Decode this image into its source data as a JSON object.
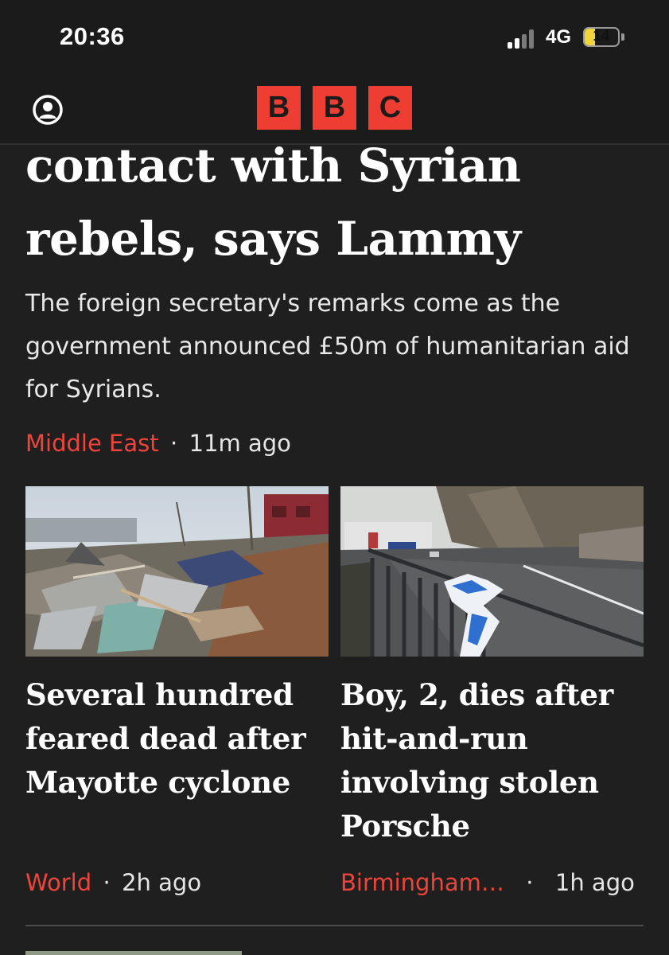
{
  "status_bar": {
    "time": "20:36",
    "network": "4G",
    "battery": "14",
    "battery_fraction": 0.3
  },
  "app_bar": {
    "account_icon": "account-icon",
    "logo_letters": [
      "B",
      "B",
      "C"
    ]
  },
  "lead_story": {
    "title": "contact with Syrian rebels, says Lammy",
    "summary": "The foreign secretary's remarks come as the government announced £50m of humanitarian aid for Syrians.",
    "category": "Middle East",
    "time": "11m ago"
  },
  "stories": [
    {
      "title": "Several hundred feared dead after Mayotte cyclone",
      "category": "World",
      "time": "2h ago"
    },
    {
      "title": "Boy, 2, dies after hit-and-run involving stolen Porsche",
      "category": "Birmingham…",
      "time": "1h ago"
    }
  ],
  "colors": {
    "background": "#1f1f1f",
    "brand_red": "#ee3e33",
    "category_red": "#f0443a",
    "battery_yellow": "#f2d43b"
  }
}
